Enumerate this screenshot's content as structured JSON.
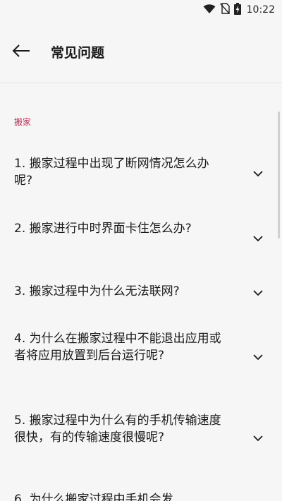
{
  "status_bar": {
    "time": "10:22",
    "icons": [
      "wifi-icon",
      "no-sim-icon",
      "battery-charging-icon"
    ]
  },
  "header": {
    "back_icon": "arrow-left-icon",
    "title": "常见问题"
  },
  "section": {
    "label": "搬家"
  },
  "faq": [
    {
      "question": "1. 搬家过程中出现了断网情况怎么办呢?"
    },
    {
      "question": "2. 搬家进行中时界面卡住怎么办?"
    },
    {
      "question": "3. 搬家过程中为什么无法联网?"
    },
    {
      "question": "4. 为什么在搬家过程中不能退出应用或者将应用放置到后台运行呢?"
    },
    {
      "question": "5. 搬家过程中为什么有的手机传输速度很快，有的传输速度很慢呢?"
    },
    {
      "question": "6. 为什么搬家过程中手机会发"
    }
  ],
  "colors": {
    "background": "#f6f6f6",
    "accent": "#c0305a",
    "text": "#1a1a1a"
  }
}
